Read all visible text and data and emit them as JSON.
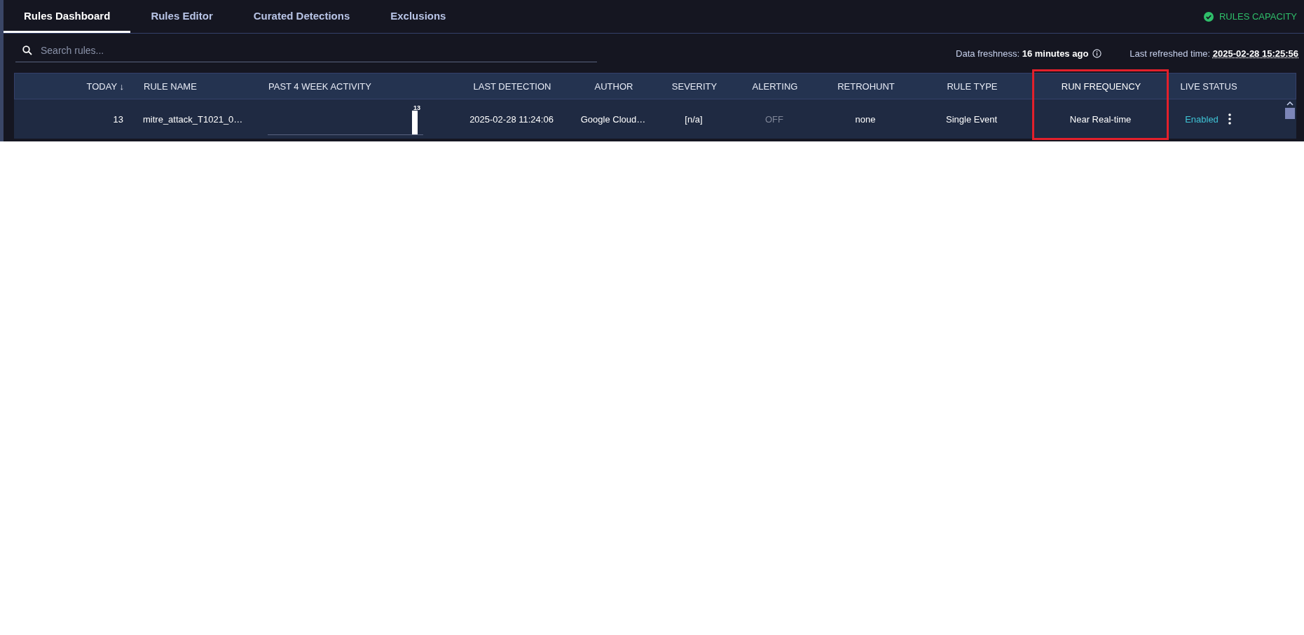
{
  "tabs": [
    {
      "label": "Rules Dashboard",
      "selected": true
    },
    {
      "label": "Rules Editor",
      "selected": false
    },
    {
      "label": "Curated Detections",
      "selected": false
    },
    {
      "label": "Exclusions",
      "selected": false
    }
  ],
  "rules_capacity": {
    "label": "RULES CAPACITY"
  },
  "search": {
    "placeholder": "Search rules..."
  },
  "data_freshness": {
    "label": "Data freshness:",
    "value": "16 minutes ago"
  },
  "last_refreshed": {
    "label": "Last refreshed time:",
    "value": "2025-02-28 15:25:56"
  },
  "table": {
    "columns": [
      {
        "label": "TODAY",
        "sort_indicator": "↓",
        "highlighted": false
      },
      {
        "label": "RULE NAME",
        "highlighted": false
      },
      {
        "label": "PAST 4 WEEK ACTIVITY",
        "highlighted": false
      },
      {
        "label": "LAST DETECTION",
        "highlighted": false
      },
      {
        "label": "AUTHOR",
        "highlighted": false
      },
      {
        "label": "SEVERITY",
        "highlighted": false
      },
      {
        "label": "ALERTING",
        "highlighted": false
      },
      {
        "label": "RETROHUNT",
        "highlighted": false
      },
      {
        "label": "RULE TYPE",
        "highlighted": false
      },
      {
        "label": "RUN FREQUENCY",
        "highlighted": true
      },
      {
        "label": "LIVE STATUS",
        "highlighted": false
      }
    ],
    "rows": [
      {
        "today": "13",
        "rule_name": "mitre_attack_T1021_0…",
        "activity_peak": "13",
        "last_detection": "2025-02-28 11:24:06",
        "author": "Google Cloud…",
        "severity": "[n/a]",
        "alerting": "OFF",
        "alerting_on": false,
        "retrohunt": "none",
        "rule_type": "Single Event",
        "run_frequency": "Near Real-time",
        "live_status": "Enabled"
      }
    ]
  }
}
